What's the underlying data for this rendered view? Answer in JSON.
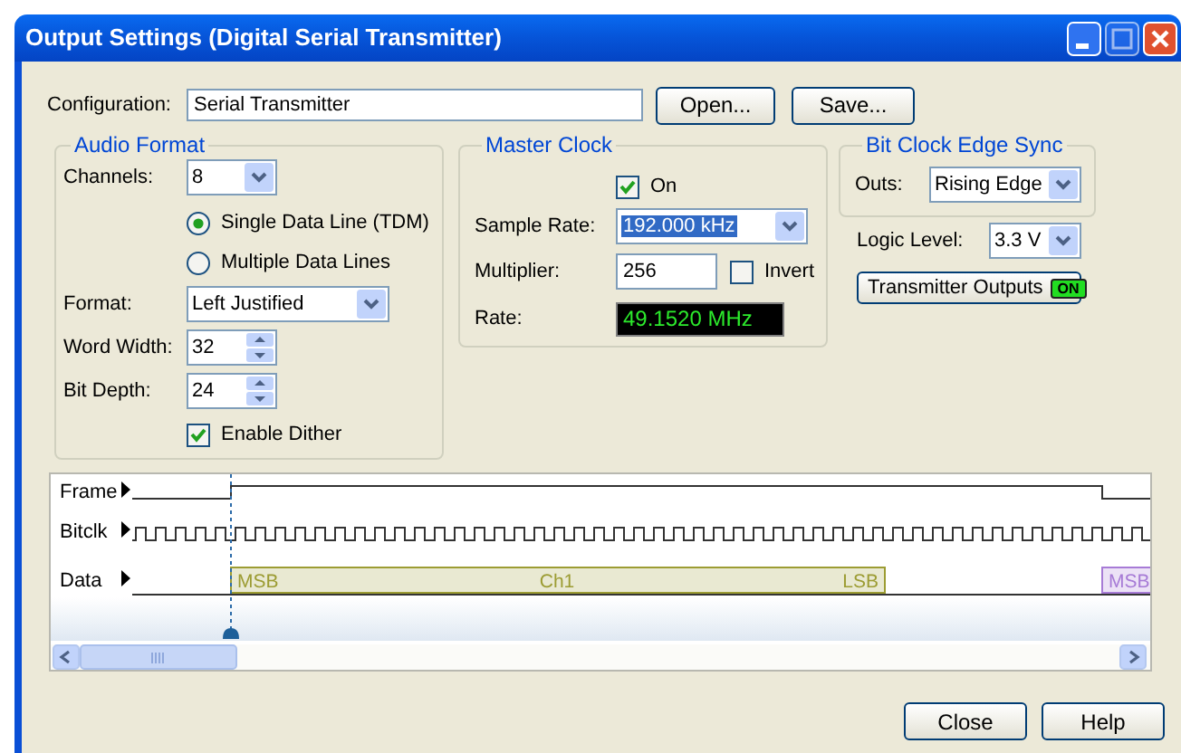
{
  "window": {
    "title": "Output Settings (Digital Serial Transmitter)"
  },
  "configuration": {
    "label": "Configuration:",
    "value": "Serial Transmitter",
    "buttons": [
      "Open...",
      "Save..."
    ]
  },
  "audio_format": {
    "title": "Audio Format",
    "channels": {
      "label": "Channels:",
      "value": "8"
    },
    "data_lines": [
      {
        "label": "Single Data Line (TDM)",
        "selected": true
      },
      {
        "label": "Multiple Data Lines",
        "selected": false
      }
    ],
    "format": {
      "label": "Format:",
      "value": "Left Justified"
    },
    "word_width": {
      "label": "Word Width:",
      "value": "32"
    },
    "bit_depth": {
      "label": "Bit Depth:",
      "value": "24"
    },
    "enable_dither": {
      "label": "Enable Dither",
      "checked": true
    }
  },
  "master_clock": {
    "title": "Master Clock",
    "on": {
      "label": "On",
      "checked": true
    },
    "sample_rate": {
      "label": "Sample Rate:",
      "value": "192.000 kHz",
      "focused": true
    },
    "multiplier": {
      "label": "Multiplier:",
      "value": "256"
    },
    "invert": {
      "label": "Invert",
      "checked": false
    },
    "rate": {
      "label": "Rate:",
      "value": "49.1520 MHz"
    }
  },
  "bit_clock_edge_sync": {
    "title": "Bit Clock Edge Sync",
    "outs": {
      "label": "Outs:",
      "value": "Rising Edge"
    }
  },
  "logic_level": {
    "label": "Logic Level:",
    "value": "3.3 V"
  },
  "transmitter_outputs": {
    "label": "Transmitter Outputs",
    "indicator": "ON",
    "on": true
  },
  "timing": {
    "signals": [
      {
        "label": "Frame"
      },
      {
        "label": "Bitclk"
      },
      {
        "label": "Data"
      }
    ],
    "data_segments": [
      {
        "texts": [
          "MSB",
          "Ch1",
          "LSB"
        ],
        "color": "#9c9c33"
      },
      {
        "texts": [
          "MSB"
        ],
        "color": "#a77bd6"
      }
    ]
  },
  "buttons": [
    "Close",
    "Help"
  ]
}
